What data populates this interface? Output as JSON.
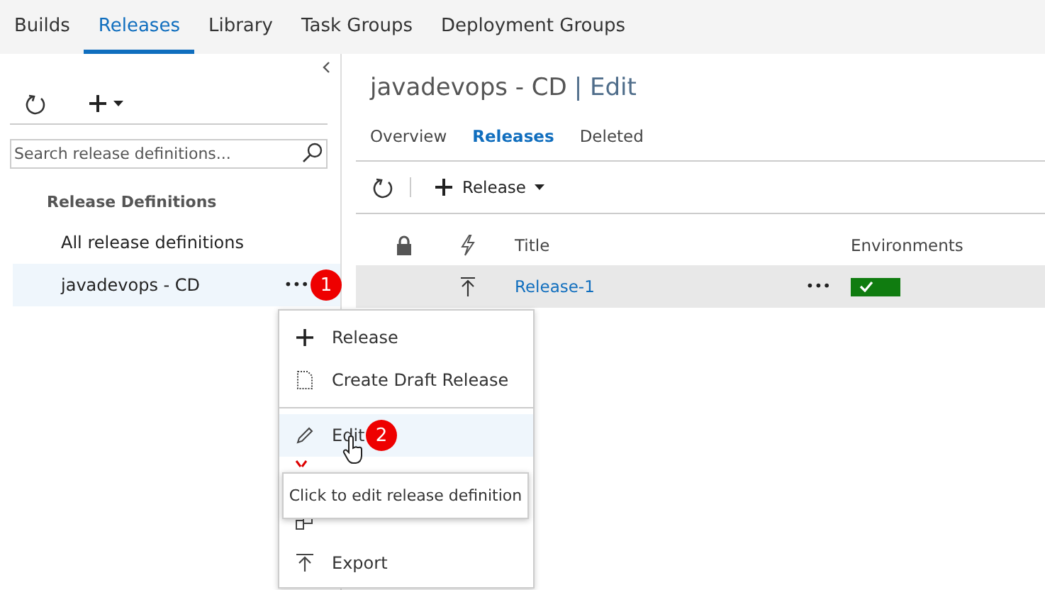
{
  "top_tabs": [
    {
      "label": "Builds",
      "selected": false
    },
    {
      "label": "Releases",
      "selected": true
    },
    {
      "label": "Library",
      "selected": false
    },
    {
      "label": "Task Groups",
      "selected": false
    },
    {
      "label": "Deployment Groups",
      "selected": false
    }
  ],
  "sidebar": {
    "search": {
      "placeholder": "Search release definitions..."
    },
    "heading": "Release Definitions",
    "items": [
      {
        "label": "All release definitions",
        "selected": false
      },
      {
        "label": "javadevops - CD",
        "selected": true,
        "more": "•••",
        "badge": "1"
      }
    ]
  },
  "main": {
    "title": "javadevops - CD",
    "title_suffix": "| Edit",
    "tabs": [
      {
        "label": "Overview",
        "selected": false
      },
      {
        "label": "Releases",
        "selected": true
      },
      {
        "label": "Deleted",
        "selected": false
      }
    ],
    "toolbar": {
      "new_button": "Release"
    },
    "table": {
      "columns": [
        {
          "kind": "lock"
        },
        {
          "kind": "trigger"
        },
        {
          "kind": "text",
          "label": "Title"
        },
        {
          "kind": "text",
          "label": "Environments"
        }
      ],
      "rows": [
        {
          "title": "Release-1",
          "more": "•••",
          "succeeded": true,
          "selected": true
        }
      ]
    }
  },
  "context_menu": {
    "items": [
      {
        "kind": "add",
        "label": "Release",
        "selected": false
      },
      {
        "kind": "draft",
        "label": "Create Draft Release",
        "selected": false
      },
      {
        "kind": "divider"
      },
      {
        "kind": "edit",
        "label": "Edit",
        "selected": true,
        "badge": "2"
      },
      {
        "kind": "covered"
      },
      {
        "kind": "clone",
        "selected": false
      },
      {
        "kind": "export",
        "label": "Export",
        "selected": false
      }
    ],
    "tooltip": "Click to edit release definition"
  }
}
